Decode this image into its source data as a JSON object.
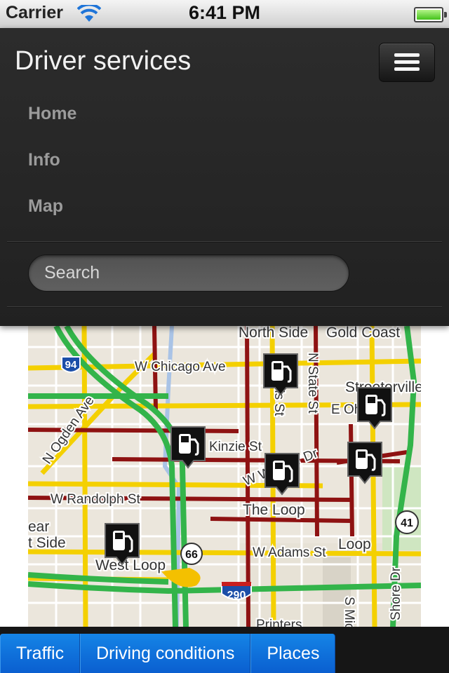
{
  "status_bar": {
    "carrier": "Carrier",
    "time": "6:41 PM"
  },
  "navbar": {
    "brand": "Driver services",
    "links": [
      "Home",
      "Info",
      "Map"
    ],
    "search_placeholder": "Search"
  },
  "map": {
    "labels": {
      "north_side": "North Side",
      "gold_coast": "Gold Coast",
      "chicago_ave": "W Chicago Ave",
      "streeterville": "Streeterville",
      "state_st": "N State St",
      "e_oh": "E Oh",
      "ogden_ave": "N Ogden Ave",
      "kinzie_st": "Kinzie St",
      "wells_st": "N Wells St",
      "w_wacker_dr": "W Wacker Dr",
      "randolph_st": "W Randolph St",
      "the_loop": "The Loop",
      "near": "ear",
      "west_side": "t Side",
      "loop": "Loop",
      "adams_st": "W Adams St",
      "west_loop": "West Loop",
      "printers": "Printers",
      "michigan": "S Mic",
      "shore_dr": "Shore Dr"
    },
    "shields": {
      "i94": "94",
      "us66": "66",
      "i290": "290",
      "us41": "41"
    },
    "markers": [
      "fuel-station-icon",
      "fuel-station-icon",
      "fuel-station-icon",
      "fuel-station-icon",
      "fuel-station-icon",
      "fuel-station-icon"
    ]
  },
  "tabs": [
    "Traffic",
    "Driving conditions",
    "Places"
  ],
  "colors": {
    "accent": "#0a6fe0",
    "navbar": "#262626",
    "traffic_green": "#33b44a",
    "traffic_yellow": "#f3d000",
    "traffic_red": "#8e1212"
  }
}
